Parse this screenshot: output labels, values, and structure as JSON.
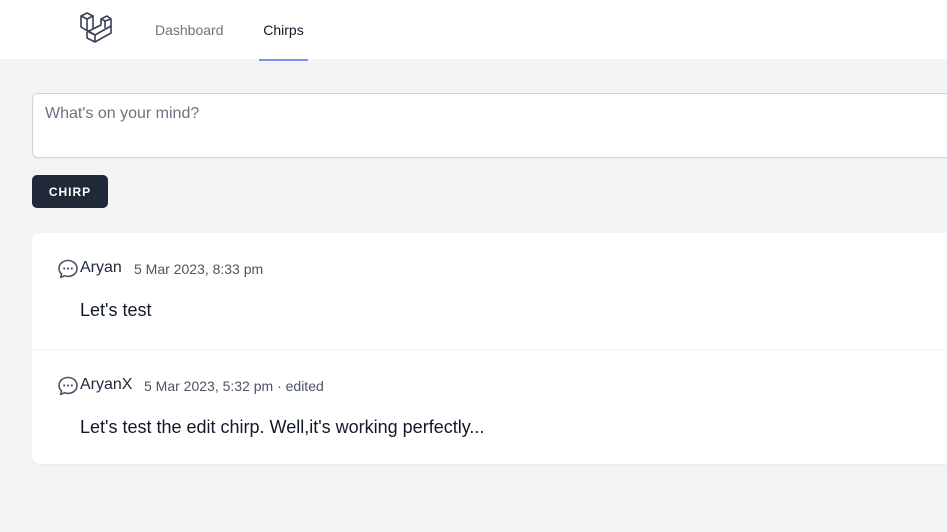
{
  "nav": {
    "logo_icon": "laravel-logo-icon",
    "links": [
      {
        "label": "Dashboard",
        "active": false
      },
      {
        "label": "Chirps",
        "active": true
      }
    ],
    "active_color": "#818cf8"
  },
  "composer": {
    "placeholder": "What's on your mind?",
    "value": "",
    "submit_label": "CHIRP"
  },
  "chirps": [
    {
      "icon": "chat-bubble-icon",
      "author": "Aryan",
      "meta": "5 Mar 2023, 8:33 pm",
      "message": "Let's test"
    },
    {
      "icon": "chat-bubble-icon",
      "author": "AryanX",
      "meta": "5 Mar 2023, 5:32 pm · edited",
      "message": "Let's test the edit chirp. Well,it's working perfectly..."
    }
  ],
  "colors": {
    "page_bg": "#f3f4f6",
    "button_bg": "#1f2937",
    "card_bg": "#ffffff"
  }
}
